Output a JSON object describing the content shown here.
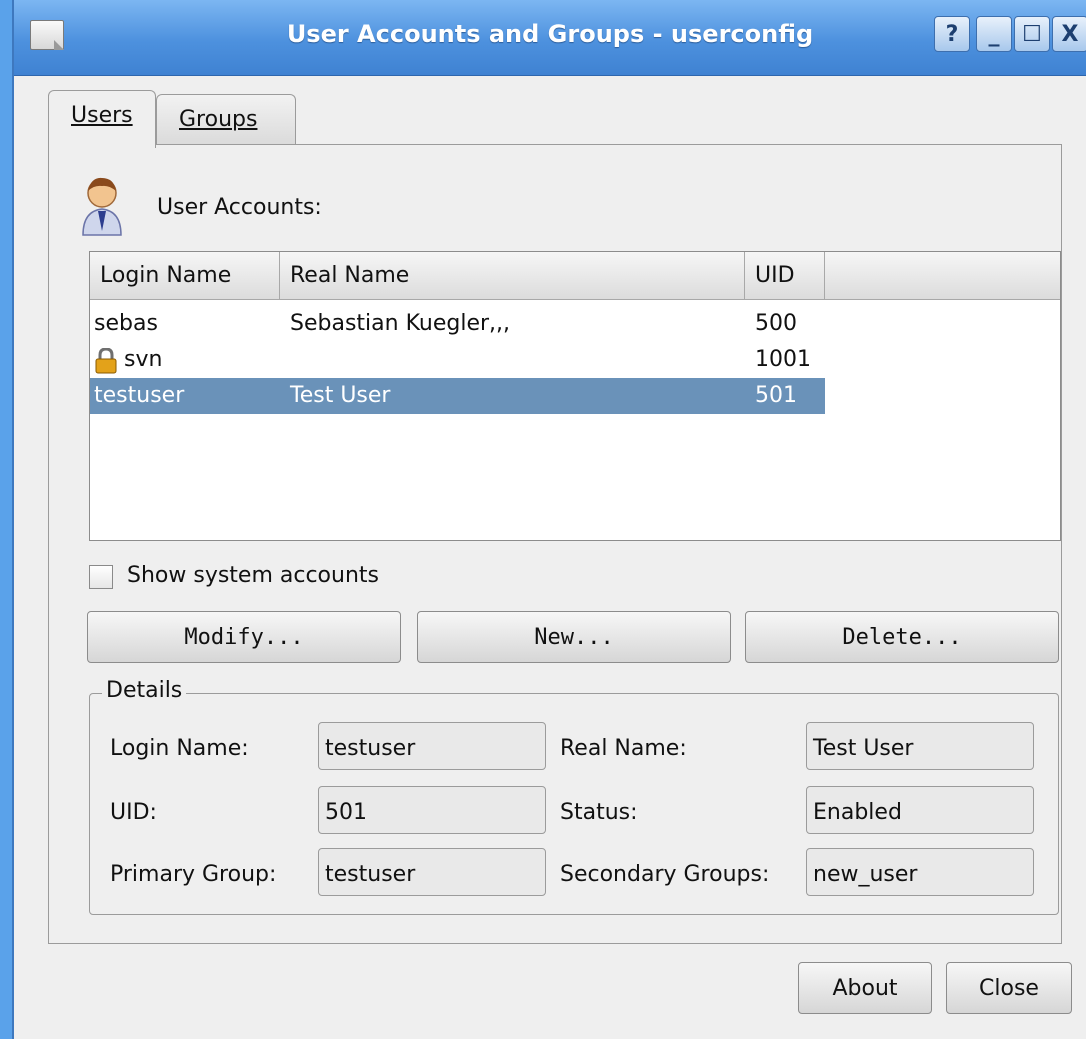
{
  "window": {
    "title": "User Accounts and Groups - userconfig",
    "buttons": {
      "help": "?",
      "minimize": "_",
      "maximize": "☐",
      "close": "X"
    }
  },
  "tabs": [
    {
      "label": "Users",
      "active": true
    },
    {
      "label": "Groups",
      "active": false
    }
  ],
  "users_section": {
    "label": "User Accounts:"
  },
  "user_list": {
    "columns": [
      "Login Name",
      "Real Name",
      "UID"
    ],
    "rows": [
      {
        "login": "sebas",
        "real_name": "Sebastian Kuegler,,,",
        "uid": "500",
        "locked": false,
        "selected": false
      },
      {
        "login": "svn",
        "real_name": "",
        "uid": "1001",
        "locked": true,
        "selected": false
      },
      {
        "login": "testuser",
        "real_name": "Test User",
        "uid": "501",
        "locked": false,
        "selected": true
      }
    ]
  },
  "show_system": {
    "label": "Show system accounts",
    "checked": false
  },
  "actions": {
    "modify": "Modify...",
    "new": "New...",
    "delete": "Delete..."
  },
  "details": {
    "title": "Details",
    "login_name_label": "Login Name:",
    "login_name": "testuser",
    "real_name_label": "Real Name:",
    "real_name": "Test User",
    "uid_label": "UID:",
    "uid": "501",
    "status_label": "Status:",
    "status": "Enabled",
    "primary_group_label": "Primary Group:",
    "primary_group": "testuser",
    "secondary_groups_label": "Secondary Groups:",
    "secondary_groups": "new_user"
  },
  "footer": {
    "about": "About",
    "close": "Close"
  },
  "colors": {
    "titlebar": "#4d91de",
    "selection": "#6a92b9",
    "window_bg": "#efefef"
  }
}
